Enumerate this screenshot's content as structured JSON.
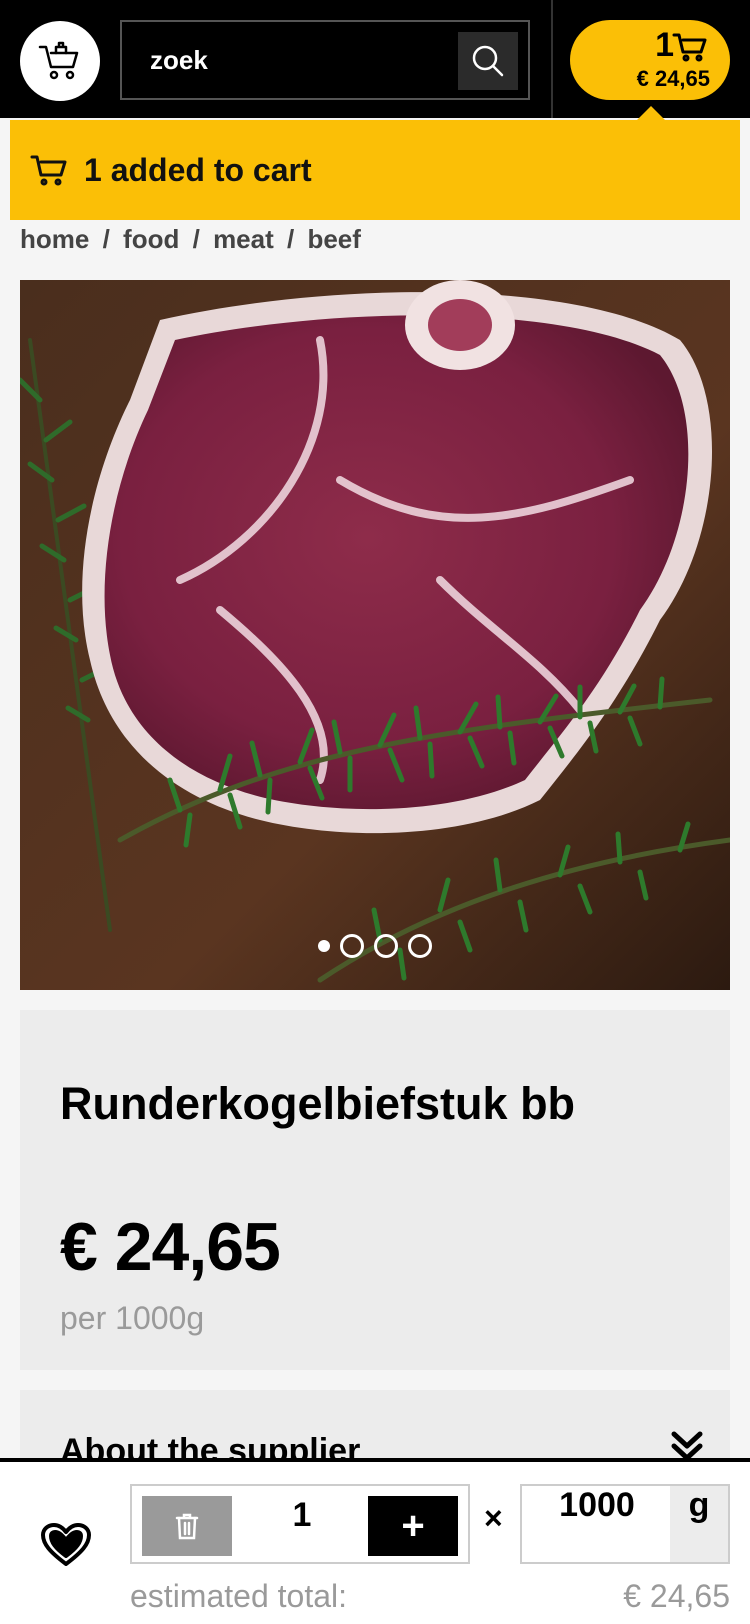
{
  "header": {
    "logo_icon": "basket-cart-icon",
    "search": {
      "placeholder": "zoek",
      "value": ""
    },
    "search_icon": "search-icon",
    "cart": {
      "count": "1",
      "total": "€ 24,65",
      "icon": "cart-icon"
    }
  },
  "toast": {
    "message": "1 added to cart",
    "icon": "cart-icon",
    "color": "#fbbf06"
  },
  "breadcrumb": {
    "items": [
      "home",
      "food",
      "meat",
      "beef"
    ],
    "separator": "/"
  },
  "gallery": {
    "image_icon": "beef-steak-photo",
    "slide_count": 4,
    "active_slide": 1
  },
  "product": {
    "title": "Runderkogelbiefstuk bb",
    "price": "€ 24,65",
    "unit": "per 1000g"
  },
  "supplier": {
    "title": "About the supplier",
    "icon": "double-chevron-down-icon"
  },
  "purchase": {
    "favorite_icon": "heart-icon",
    "delete_icon": "trash-icon",
    "quantity": "1",
    "plus_label": "+",
    "times": "×",
    "weight": "1000",
    "weight_unit": "g",
    "estimated_label": "estimated total:",
    "estimated_total": "€ 24,65"
  },
  "colors": {
    "accent": "#fbbf06",
    "header_bg": "#000000",
    "card_bg": "#ececec"
  }
}
